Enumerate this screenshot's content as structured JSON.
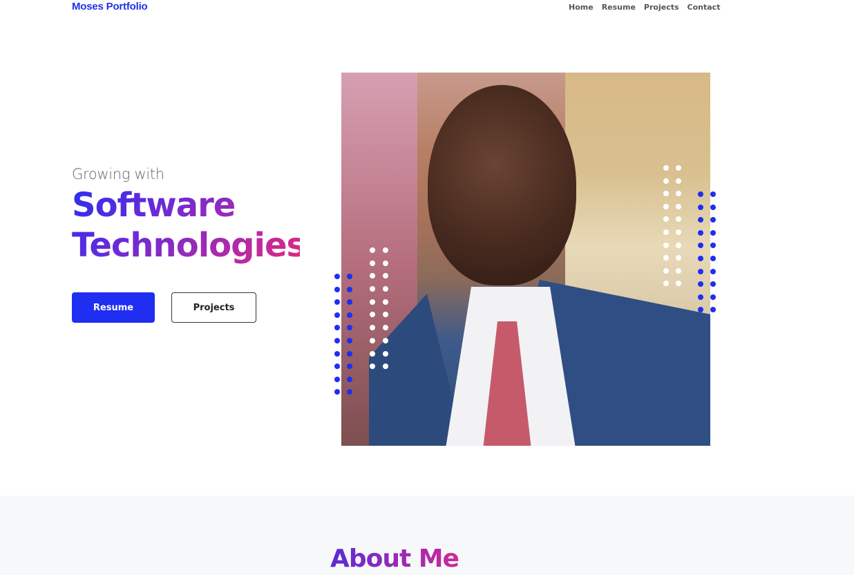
{
  "nav": {
    "brand": "Moses Portfolio",
    "links": [
      "Home",
      "Resume",
      "Projects",
      "Contact"
    ]
  },
  "hero": {
    "tagline": "Growing with",
    "headline_line1": "Software",
    "headline_line2": "Technologies",
    "buttons": {
      "primary": "Resume",
      "secondary": "Projects"
    },
    "photo_alt": "Portrait photo",
    "colors": {
      "accent": "#1f2ef0",
      "gradient_start": "#2a2ff0",
      "gradient_end": "#e3287a"
    }
  },
  "about": {
    "title": "About Me"
  }
}
